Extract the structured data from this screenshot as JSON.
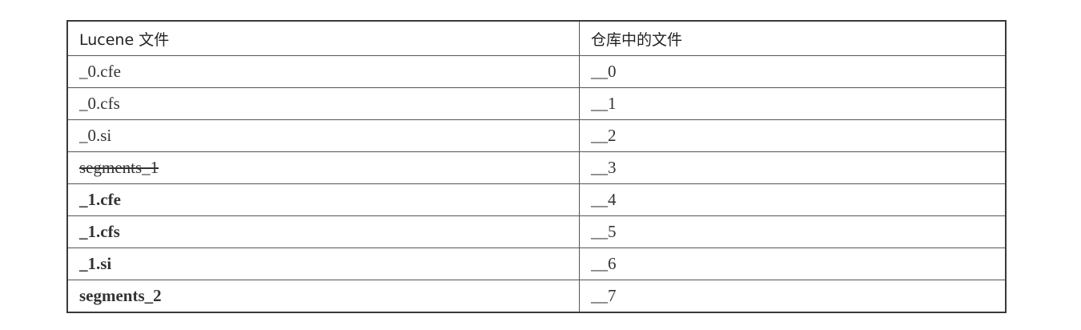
{
  "table": {
    "headers": [
      "Lucene 文件",
      "仓库中的文件"
    ],
    "rows": [
      {
        "lucene": "_0.cfe",
        "repo": "__0",
        "style": "normal"
      },
      {
        "lucene": "_0.cfs",
        "repo": "__1",
        "style": "normal"
      },
      {
        "lucene": "_0.si",
        "repo": "__2",
        "style": "normal"
      },
      {
        "lucene": "segments_1",
        "repo": "__3",
        "style": "strikethrough"
      },
      {
        "lucene": "_1.cfe",
        "repo": "__4",
        "style": "bold"
      },
      {
        "lucene": "_1.cfs",
        "repo": "__5",
        "style": "bold"
      },
      {
        "lucene": "_1.si",
        "repo": "__6",
        "style": "bold"
      },
      {
        "lucene": "segments_2",
        "repo": "__7",
        "style": "bold"
      }
    ]
  }
}
